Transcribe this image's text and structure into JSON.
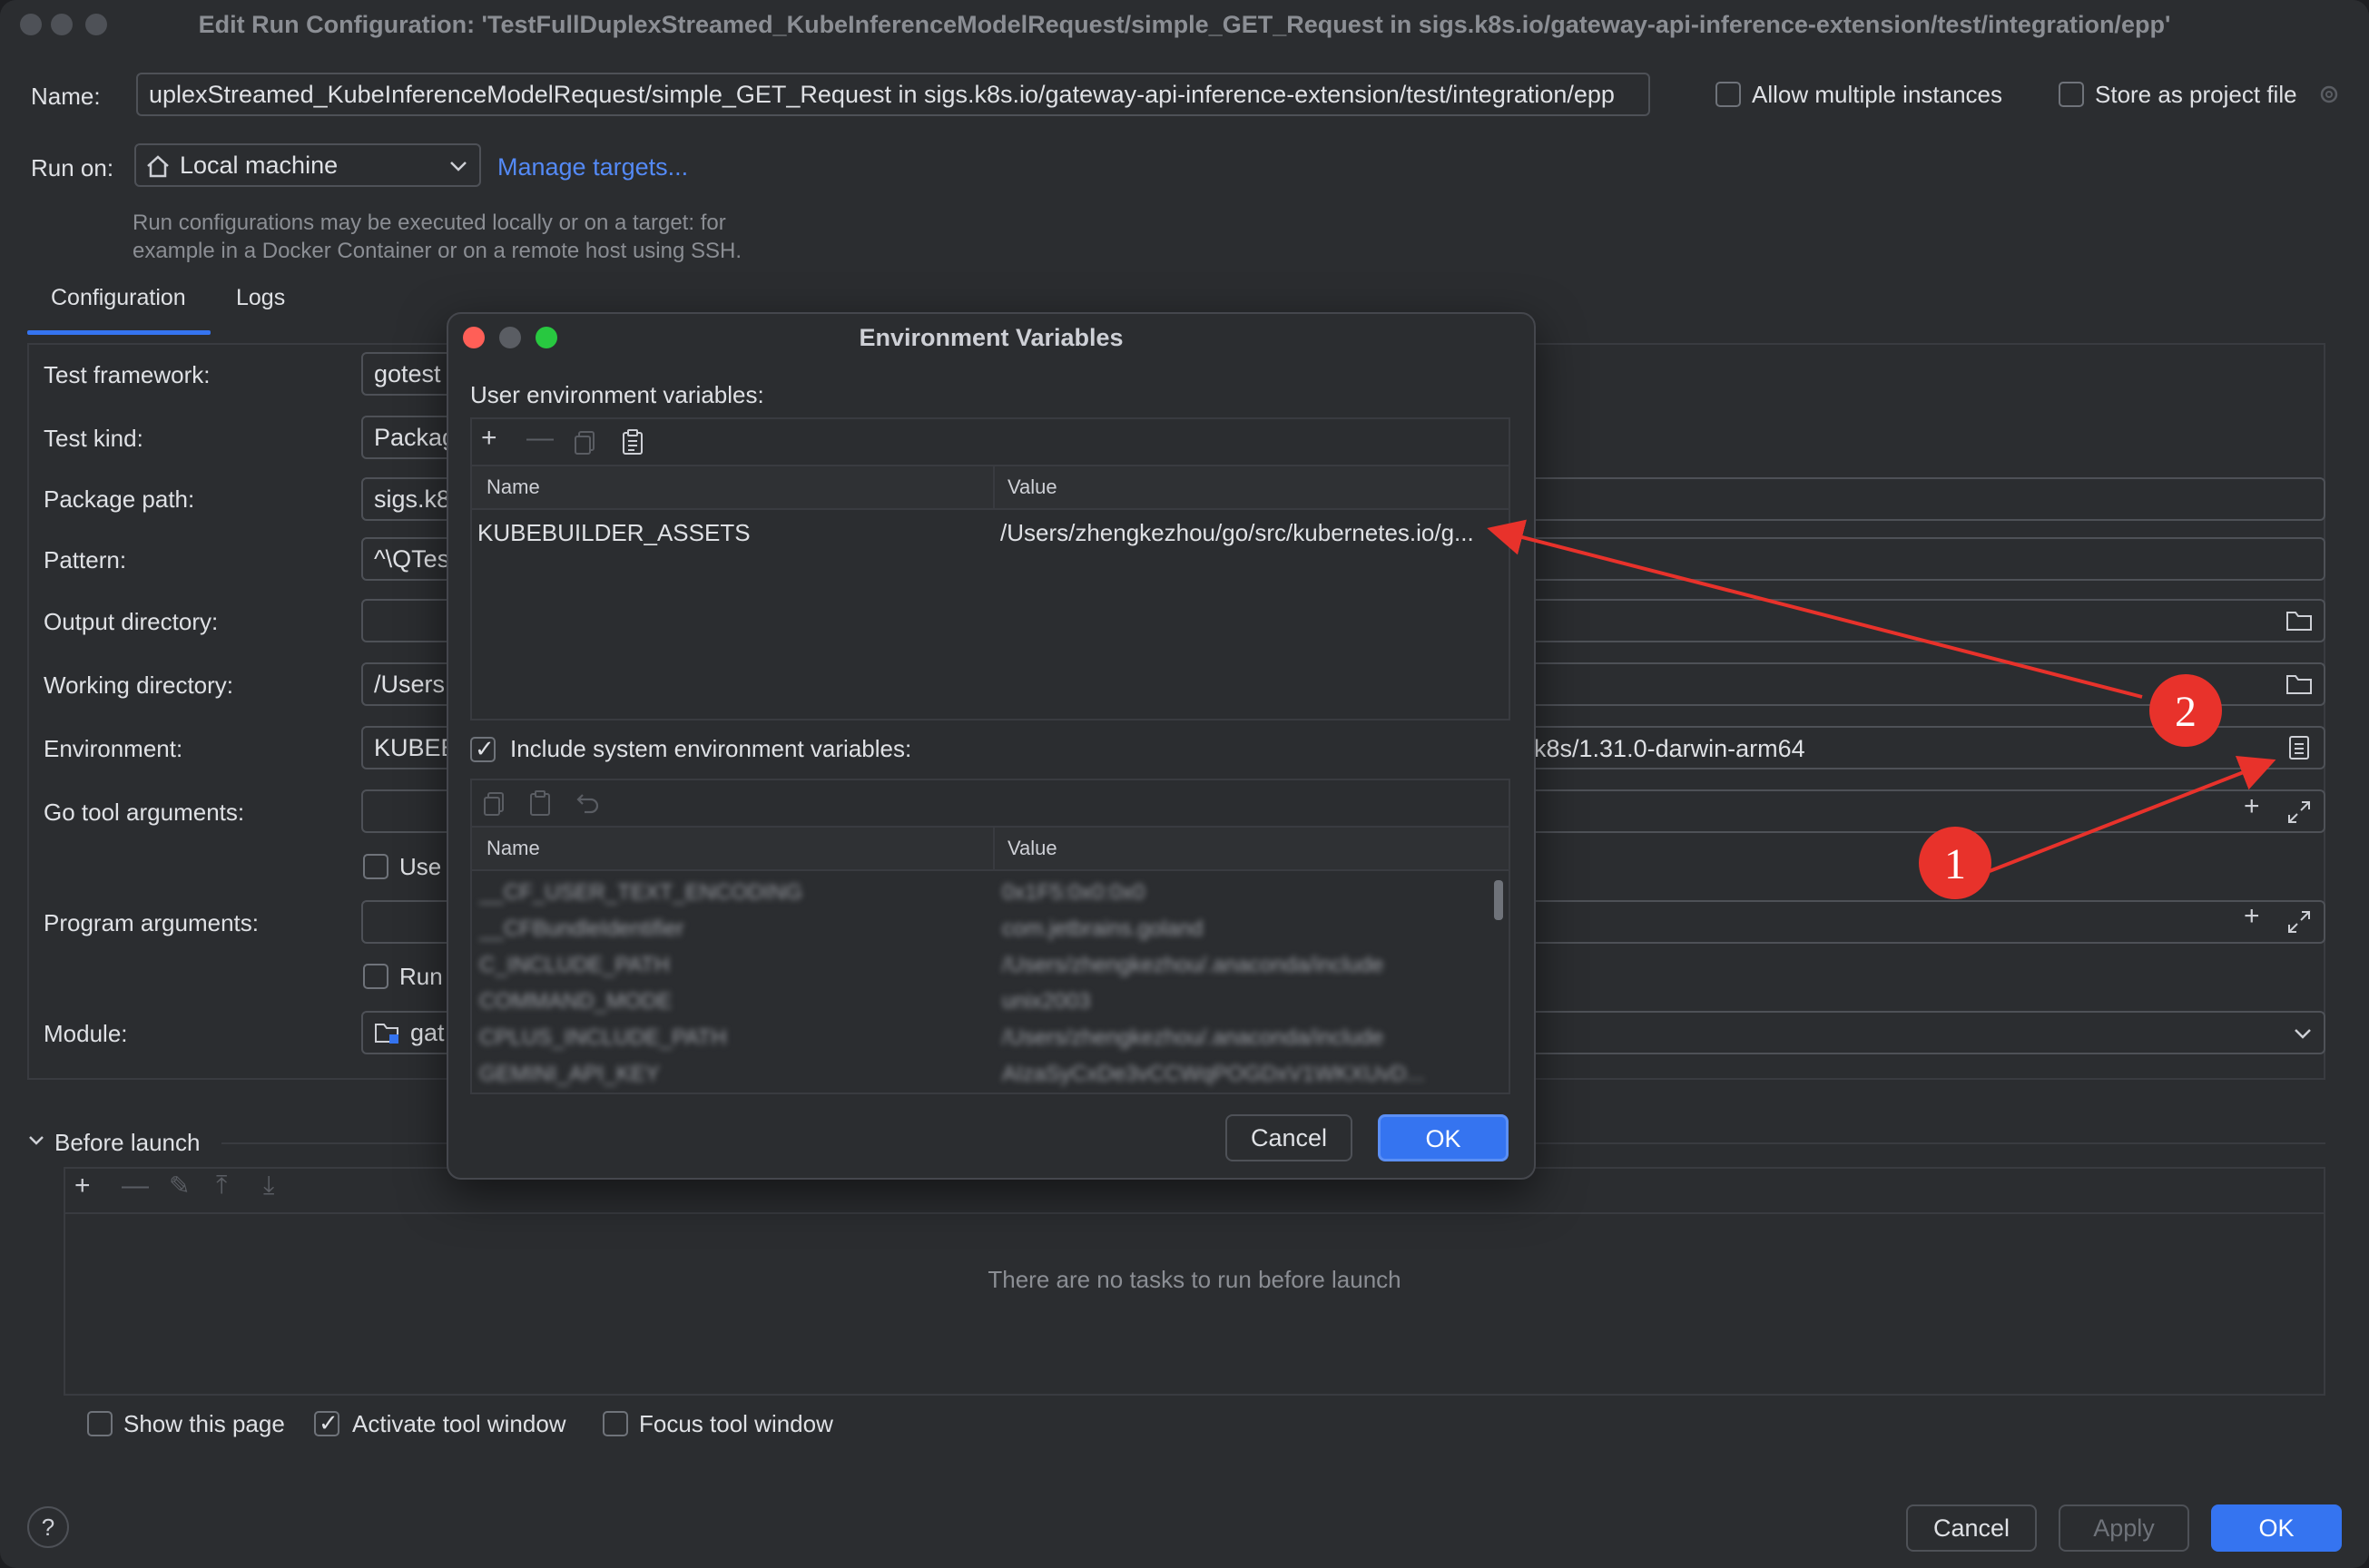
{
  "window": {
    "title": "Edit Run Configuration: 'TestFullDuplexStreamed_KubeInferenceModelRequest/simple_GET_Request in sigs.k8s.io/gateway-api-inference-extension/test/integration/epp'"
  },
  "header": {
    "name_label": "Name:",
    "name_value": "uplexStreamed_KubeInferenceModelRequest/simple_GET_Request in sigs.k8s.io/gateway-api-inference-extension/test/integration/epp",
    "allow_multiple_label": "Allow multiple instances",
    "store_as_project_label": "Store as project file",
    "run_on_label": "Run on:",
    "run_on_value": "Local machine",
    "manage_targets_label": "Manage targets...",
    "hint_line1": "Run configurations may be executed locally or on a target: for",
    "hint_line2": "example in a Docker Container or on a remote host using SSH."
  },
  "tabs": [
    {
      "label": "Configuration",
      "active": true
    },
    {
      "label": "Logs",
      "active": false
    }
  ],
  "form": {
    "test_framework": {
      "label": "Test framework:",
      "value": "gotest"
    },
    "test_kind": {
      "label": "Test kind:",
      "value": "Packag"
    },
    "package_path": {
      "label": "Package path:",
      "value": "sigs.k8"
    },
    "pattern": {
      "label": "Pattern:",
      "value": "^\\QTes"
    },
    "output_directory": {
      "label": "Output directory:",
      "value": ""
    },
    "working_directory": {
      "label": "Working directory:",
      "value": "/Users"
    },
    "environment": {
      "label": "Environment:",
      "value_left": "KUBEB",
      "value_right": "k8s/1.31.0-darwin-arm64"
    },
    "go_tool_arguments": {
      "label": "Go tool arguments:",
      "value": ""
    },
    "use_checkbox_label": "Use",
    "program_arguments": {
      "label": "Program arguments:",
      "value": ""
    },
    "run_checkbox_label": "Run",
    "module": {
      "label": "Module:",
      "value": "gat"
    }
  },
  "before_launch": {
    "title": "Before launch",
    "empty_message": "There are no tasks to run before launch"
  },
  "footer": {
    "show_this_page": "Show this page",
    "activate_tool_window": "Activate tool window",
    "focus_tool_window": "Focus tool window",
    "cancel": "Cancel",
    "apply": "Apply",
    "ok": "OK",
    "help": "?"
  },
  "env_dialog": {
    "title": "Environment Variables",
    "user_section_label": "User environment variables:",
    "col_name": "Name",
    "col_value": "Value",
    "user_vars": [
      {
        "name": "KUBEBUILDER_ASSETS",
        "value": "/Users/zhengkezhou/go/src/kubernetes.io/g..."
      }
    ],
    "include_system_label": "Include system environment variables:",
    "system_vars": [
      {
        "name": "__CF_USER_TEXT_ENCODING",
        "value": "0x1F5:0x0:0x0"
      },
      {
        "name": "__CFBundleIdentifier",
        "value": "com.jetbrains.goland"
      },
      {
        "name": "C_INCLUDE_PATH",
        "value": "/Users/zhengkezhou/.anaconda/include"
      },
      {
        "name": "COMMAND_MODE",
        "value": "unix2003"
      },
      {
        "name": "CPLUS_INCLUDE_PATH",
        "value": "/Users/zhengkezhou/.anaconda/include"
      },
      {
        "name": "GEMINI_API_KEY",
        "value": "AIzaSyCxDe3vCCWqPOGDxV1WKXUvD..."
      }
    ],
    "cancel": "Cancel",
    "ok": "OK"
  },
  "annotations": [
    {
      "label": "1"
    },
    {
      "label": "2"
    }
  ],
  "colors": {
    "window_bg": "#2b2d30",
    "accent": "#3574f0",
    "link": "#548af7",
    "annotation_red": "#e8322b",
    "close_red": "#ff5f57",
    "min_yellow": "#febc2e",
    "max_green": "#28c840"
  }
}
